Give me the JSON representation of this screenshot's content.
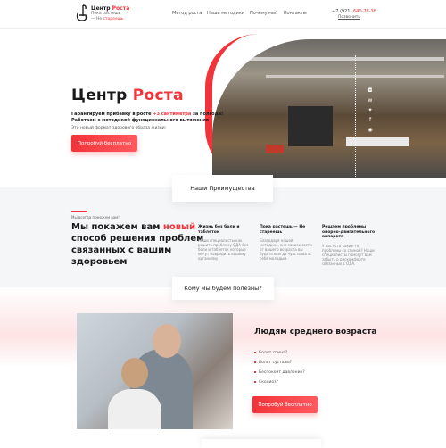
{
  "header": {
    "brand_a": "Центр ",
    "brand_b": "Роста",
    "tag_a": "Пока растешь",
    "tag_b": "— Не ",
    "tag_c": "стареешь",
    "nav": [
      "Метод роста",
      "Наши методики",
      "Почему мы?",
      "Контакты"
    ],
    "phone_a": "+7 (921) ",
    "phone_b": "640-78-38",
    "callback": "Позвонить"
  },
  "hero": {
    "title_a": "Центр ",
    "title_b": "Роста",
    "sub_a": "Гарантируем прибавку в росте ",
    "sub_b": "+3 сантиметра",
    "sub_c": " за полгода!",
    "sub_d": "Работаем с методикой функционального вытяжения",
    "small": "Это новый формат здорового образа жизни:",
    "cta": "Попробуй бесплатно",
    "social": [
      "instagram",
      "vk",
      "twitter",
      "facebook",
      "odnoklassniki"
    ]
  },
  "advantages": {
    "card": "Наши Преимущества",
    "eyebrow": "Мы всегда поможем вам!",
    "h_a": "Мы покажем вам ",
    "h_b": "новый",
    "h_c": " способ решения проблем связанных с вашим здоровьем",
    "features": [
      {
        "title": "Жизнь без боли и таблеток",
        "text": "Наши специалисты как решить проблему ОДА без боли и таблеток которые могут навредить вашему организму"
      },
      {
        "title": "Пока растешь — Не стареешь",
        "text": "Благодаря нашей методике, вне зависимости от вашего возраста вы будете всегда чувствовать себя молодым."
      },
      {
        "title": "Решаем проблемы опорно-двигательного аппарата",
        "text": "У вас есть какие-то проблемы со спиной? Наши специалисты помогут вам забыть о дискомфорте связанных с ОДА."
      }
    ]
  },
  "audience": {
    "card": "Кому мы будем полезны?",
    "title": "Людям среднего возраста",
    "items": [
      "Болит спина?",
      "Болят суставы?",
      "Беспокоит давление?",
      "Сколиоз?"
    ],
    "cta": "Попробуй бесплатно"
  },
  "colors": {
    "accent": "#f2333a"
  }
}
